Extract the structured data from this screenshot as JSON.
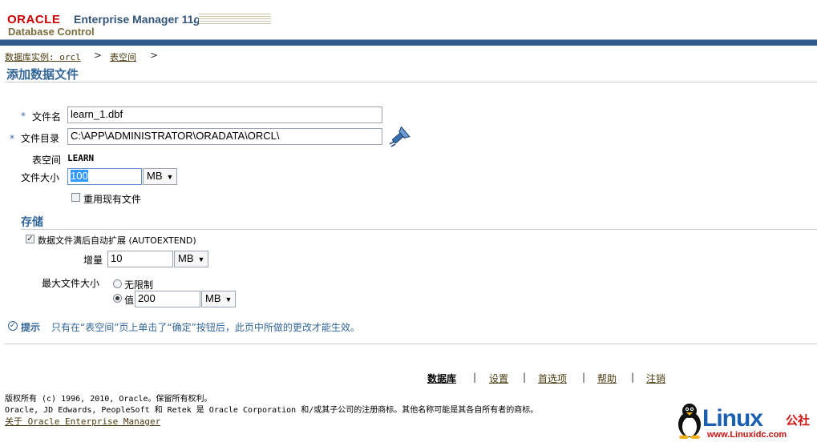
{
  "header": {
    "oracle_word": "ORACLE",
    "product": "Enterprise Manager 11",
    "version_letter": "g",
    "subtitle": "Database Control",
    "colors": {
      "bar": "#2f5a8a",
      "oracle_red": "#cc0000",
      "link": "#4a3b10",
      "title": "#336699"
    }
  },
  "breadcrumb": {
    "items": [
      "数据库实例: orcl",
      "表空间"
    ],
    "separator": ">"
  },
  "page_title": "添加数据文件",
  "form": {
    "required_mark": "*",
    "file_name": {
      "label": "文件名",
      "value": "learn_1.dbf"
    },
    "file_dir": {
      "label": "文件目录",
      "value": "C:\\APP\\ADMINISTRATOR\\ORADATA\\ORCL\\",
      "icon": "flashlight-icon"
    },
    "tablespace": {
      "label": "表空间",
      "value": "LEARN"
    },
    "file_size": {
      "label": "文件大小",
      "value": "100",
      "unit": "MB"
    },
    "reuse_checkbox": {
      "label": "重用现有文件",
      "checked": false
    }
  },
  "storage": {
    "title": "存储",
    "autoextend": {
      "label": "数据文件满后自动扩展 (AUTOEXTEND)",
      "checked": true
    },
    "increment": {
      "label": "增量",
      "value": "10",
      "unit": "MB"
    },
    "max_size": {
      "label": "最大文件大小",
      "unlimited_label": "无限制",
      "value_label": "值",
      "value": "200",
      "unit": "MB",
      "selected": "value"
    }
  },
  "tip": {
    "label": "提示",
    "text": "只有在“表空间”页上单击了“确定”按钮后，此页中所做的更改才能生效。"
  },
  "footer": {
    "links": [
      "数据库",
      "设置",
      "首选项",
      "帮助",
      "注销"
    ],
    "separator": "|",
    "copyright_1": "版权所有 (c) 1996, 2010, Oracle。保留所有权利。",
    "copyright_2": "Oracle, JD Edwards, PeopleSoft 和 Retek 是 Oracle Corporation 和/或其子公司的注册商标。其他名称可能是其各自所有者的商标。",
    "about_link": "关于 Oracle Enterprise Manager"
  },
  "watermark": {
    "brand": "Linux",
    "brand_cn": "公社",
    "url": "www.Linuxidc.com",
    "icon": "penguin-icon"
  }
}
